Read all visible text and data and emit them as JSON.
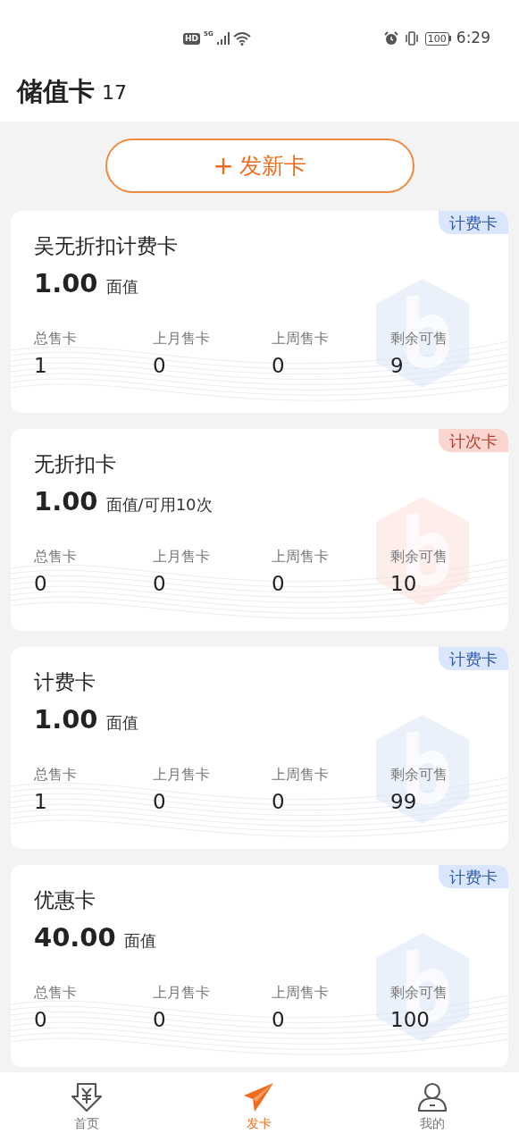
{
  "status_bar": {
    "hd": "HD",
    "network": "5G",
    "battery": "100",
    "time": "6:29"
  },
  "header": {
    "title": "储值卡",
    "count": "17"
  },
  "new_card_button": {
    "icon": "+",
    "label": "发新卡"
  },
  "cards": [
    {
      "name": "吴无折扣计费卡",
      "value": "1.00",
      "unit": "面值",
      "tag": {
        "label": "计费卡",
        "kind": "billing"
      },
      "stats": [
        {
          "label": "总售卡",
          "value": "1"
        },
        {
          "label": "上月售卡",
          "value": "0"
        },
        {
          "label": "上周售卡",
          "value": "0"
        },
        {
          "label": "剩余可售",
          "value": "9"
        }
      ]
    },
    {
      "name": "无折扣卡",
      "value": "1.00",
      "unit": "面值/可用10次",
      "tag": {
        "label": "计次卡",
        "kind": "count"
      },
      "stats": [
        {
          "label": "总售卡",
          "value": "0"
        },
        {
          "label": "上月售卡",
          "value": "0"
        },
        {
          "label": "上周售卡",
          "value": "0"
        },
        {
          "label": "剩余可售",
          "value": "10"
        }
      ]
    },
    {
      "name": "计费卡",
      "value": "1.00",
      "unit": "面值",
      "tag": {
        "label": "计费卡",
        "kind": "billing"
      },
      "stats": [
        {
          "label": "总售卡",
          "value": "1"
        },
        {
          "label": "上月售卡",
          "value": "0"
        },
        {
          "label": "上周售卡",
          "value": "0"
        },
        {
          "label": "剩余可售",
          "value": "99"
        }
      ]
    },
    {
      "name": "优惠卡",
      "value": "40.00",
      "unit": "面值",
      "tag": {
        "label": "计费卡",
        "kind": "billing"
      },
      "stats": [
        {
          "label": "总售卡",
          "value": "0"
        },
        {
          "label": "上月售卡",
          "value": "0"
        },
        {
          "label": "上周售卡",
          "value": "0"
        },
        {
          "label": "剩余可售",
          "value": "100"
        }
      ]
    }
  ],
  "tab_bar": [
    {
      "label": "首页",
      "kind": "home",
      "selected": false
    },
    {
      "label": "发卡",
      "kind": "send",
      "selected": true
    },
    {
      "label": "我的",
      "kind": "user",
      "selected": false
    }
  ]
}
